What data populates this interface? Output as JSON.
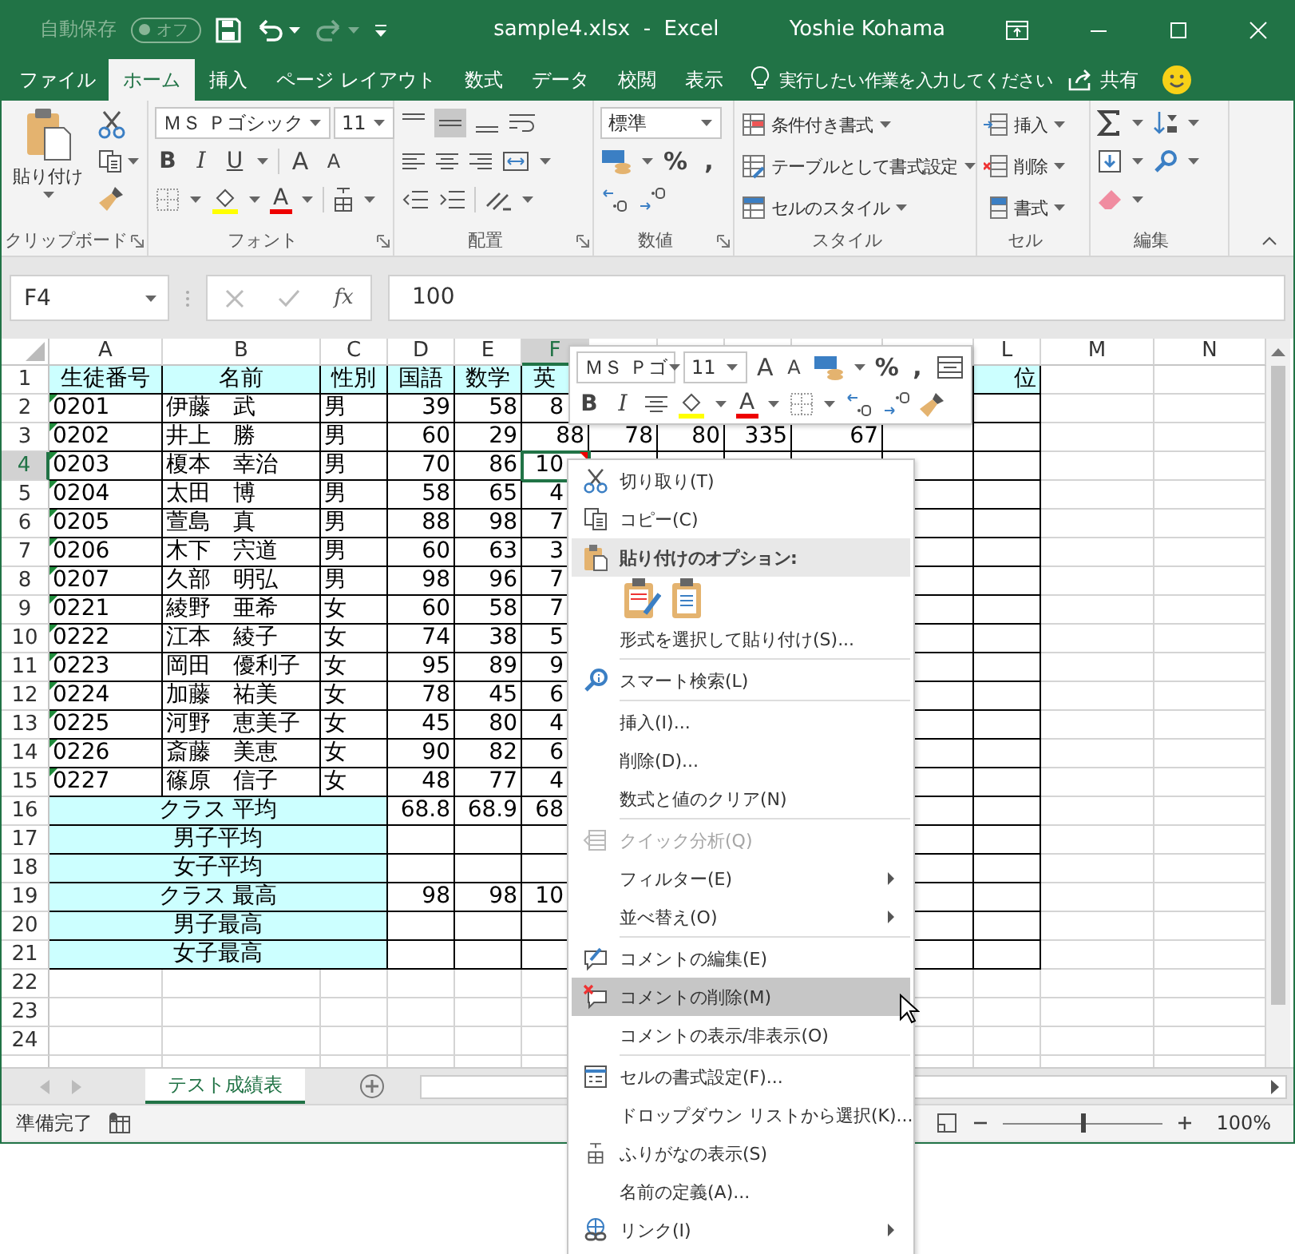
{
  "title_bar": {
    "autosave_label": "自動保存",
    "autosave_state": "オフ",
    "autosave_on": false,
    "redo_enabled": false,
    "title": "sample4.xlsx  -  Excel",
    "user": "Yoshie Kohama"
  },
  "tabs": [
    {
      "label": "ファイル",
      "selected": false
    },
    {
      "label": "ホーム",
      "selected": true
    },
    {
      "label": "挿入",
      "selected": false
    },
    {
      "label": "ページ レイアウト",
      "selected": false
    },
    {
      "label": "数式",
      "selected": false
    },
    {
      "label": "データ",
      "selected": false
    },
    {
      "label": "校閲",
      "selected": false
    },
    {
      "label": "表示",
      "selected": false
    }
  ],
  "tell_me": "実行したい作業を入力してください",
  "share": "共有",
  "ribbon": {
    "clipboard": {
      "paste": "貼り付け",
      "label": "クリップボード"
    },
    "font": {
      "font_name": "ＭＳ Ｐゴシック",
      "font_size": "11",
      "bold": "B",
      "italic": "I",
      "underline": "U",
      "grow": "A",
      "shrink": "A",
      "font_color": "A",
      "label": "フォント"
    },
    "alignment": {
      "label": "配置"
    },
    "number": {
      "format": "標準",
      "percent": "%",
      "comma": ",",
      "label": "数値"
    },
    "styles": {
      "items": [
        "条件付き書式",
        "テーブルとして書式設定",
        "セルのスタイル"
      ],
      "label": "スタイル"
    },
    "cells": {
      "items": [
        "挿入",
        "削除",
        "書式"
      ],
      "label": "セル"
    },
    "editing": {
      "label": "編集"
    }
  },
  "formula_bar": {
    "name_box": "F4",
    "function_button": "fx",
    "value": "100"
  },
  "sheet": {
    "columns": [
      {
        "label": "A",
        "selected": false
      },
      {
        "label": "B",
        "selected": false
      },
      {
        "label": "C",
        "selected": false
      },
      {
        "label": "D",
        "selected": false
      },
      {
        "label": "E",
        "selected": false
      },
      {
        "label": "F",
        "selected": true
      },
      {
        "selected": false
      },
      {
        "selected": false
      },
      {
        "selected": false
      },
      {
        "selected": false
      },
      {
        "selected": false
      },
      {
        "label": "L",
        "selected": false
      },
      {
        "label": "M",
        "selected": false
      },
      {
        "label": "N",
        "selected": false
      }
    ],
    "rows": [
      {
        "n": "1",
        "kind": "header",
        "selected": false,
        "cells": {
          "A": "生徒番号",
          "B": "名前",
          "C": "性別",
          "D": "国語",
          "E": "数学",
          "F": "英",
          "L": "位"
        }
      },
      {
        "n": "2",
        "kind": "data",
        "selected": false,
        "flag": true,
        "cells": {
          "A": "0201",
          "B": "伊藤　武",
          "C": "男",
          "D": "39",
          "E": "58",
          "F": "8"
        }
      },
      {
        "n": "3",
        "kind": "data",
        "selected": false,
        "flag": true,
        "cells": {
          "A": "0202",
          "B": "井上　勝",
          "C": "男",
          "D": "60",
          "E": "29",
          "F": "88",
          "G": "78",
          "H": "80",
          "I": "335",
          "J": "67"
        }
      },
      {
        "n": "4",
        "kind": "data",
        "selected": true,
        "flag": true,
        "cells": {
          "A": "0203",
          "B": "榎本　幸治",
          "C": "男",
          "D": "70",
          "E": "86",
          "F": {
            "text": "10",
            "comment": true
          }
        }
      },
      {
        "n": "5",
        "kind": "data",
        "selected": false,
        "flag": true,
        "cells": {
          "A": "0204",
          "B": "太田　博",
          "C": "男",
          "D": "58",
          "E": "65",
          "F": "4"
        }
      },
      {
        "n": "6",
        "kind": "data",
        "selected": false,
        "flag": true,
        "cells": {
          "A": "0205",
          "B": "萱島　真",
          "C": "男",
          "D": "88",
          "E": "98",
          "F": "7"
        }
      },
      {
        "n": "7",
        "kind": "data",
        "selected": false,
        "flag": true,
        "cells": {
          "A": "0206",
          "B": "木下　宍道",
          "C": "男",
          "D": "60",
          "E": "63",
          "F": "3"
        }
      },
      {
        "n": "8",
        "kind": "data",
        "selected": false,
        "flag": true,
        "cells": {
          "A": "0207",
          "B": "久部　明弘",
          "C": "男",
          "D": "98",
          "E": "96",
          "F": "7"
        }
      },
      {
        "n": "9",
        "kind": "data",
        "selected": false,
        "flag": true,
        "cells": {
          "A": "0221",
          "B": "綾野　亜希",
          "C": "女",
          "D": "60",
          "E": "58",
          "F": "7"
        }
      },
      {
        "n": "10",
        "kind": "data",
        "selected": false,
        "flag": true,
        "cells": {
          "A": "0222",
          "B": "江本　綾子",
          "C": "女",
          "D": "74",
          "E": "38",
          "F": "5"
        }
      },
      {
        "n": "11",
        "kind": "data",
        "selected": false,
        "flag": true,
        "cells": {
          "A": "0223",
          "B": "岡田　優利子",
          "C": "女",
          "D": "95",
          "E": "89",
          "F": "9"
        }
      },
      {
        "n": "12",
        "kind": "data",
        "selected": false,
        "flag": true,
        "cells": {
          "A": "0224",
          "B": "加藤　祐美",
          "C": "女",
          "D": "78",
          "E": "45",
          "F": "6"
        }
      },
      {
        "n": "13",
        "kind": "data",
        "selected": false,
        "flag": true,
        "cells": {
          "A": "0225",
          "B": "河野　恵美子",
          "C": "女",
          "D": "45",
          "E": "80",
          "F": "4"
        }
      },
      {
        "n": "14",
        "kind": "data",
        "selected": false,
        "flag": true,
        "cells": {
          "A": "0226",
          "B": "斎藤　美恵",
          "C": "女",
          "D": "90",
          "E": "82",
          "F": "6"
        }
      },
      {
        "n": "15",
        "kind": "data",
        "selected": false,
        "flag": true,
        "cells": {
          "A": "0227",
          "B": "篠原　信子",
          "C": "女",
          "D": "48",
          "E": "77",
          "F": "4"
        }
      },
      {
        "n": "16",
        "kind": "summary",
        "selected": false,
        "cells": {
          "A": "クラス 平均",
          "D": "68.8",
          "E": "68.9",
          "F": "68"
        }
      },
      {
        "n": "17",
        "kind": "summary",
        "selected": false,
        "cells": {
          "A": "男子平均"
        }
      },
      {
        "n": "18",
        "kind": "summary",
        "selected": false,
        "cells": {
          "A": "女子平均"
        }
      },
      {
        "n": "19",
        "kind": "summary",
        "selected": false,
        "cells": {
          "A": "クラス 最高",
          "D": "98",
          "E": "98",
          "F": "10"
        }
      },
      {
        "n": "20",
        "kind": "summary",
        "selected": false,
        "cells": {
          "A": "男子最高"
        }
      },
      {
        "n": "21",
        "kind": "summary",
        "selected": false,
        "cells": {
          "A": "女子最高"
        }
      },
      {
        "n": "22",
        "kind": "blank",
        "selected": false
      },
      {
        "n": "23",
        "kind": "blank",
        "selected": false
      },
      {
        "n": "24",
        "kind": "blank",
        "selected": false
      },
      {
        "kind": "blank",
        "selected": false
      }
    ]
  },
  "sheet_tabs": [
    {
      "label": "テスト成績表",
      "selected": true
    }
  ],
  "status_bar": {
    "status": "準備完了",
    "zoom": {
      "level": 0.5,
      "reading": "100%"
    }
  },
  "mini_toolbar": {
    "font_name": "ＭＳ Ｐゴ",
    "font_size": "11",
    "grow": "A",
    "shrink": "A",
    "percent": "%",
    "comma": ",",
    "bold": "B",
    "italic": "I",
    "font_color": "A"
  },
  "context_menu": {
    "items": [
      {
        "kind": "item",
        "label": "切り取り(T)",
        "disabled": false,
        "selected": false,
        "submenu": false
      },
      {
        "kind": "item",
        "label": "コピー(C)",
        "disabled": false,
        "selected": false,
        "submenu": false
      },
      {
        "kind": "header",
        "label": "貼り付けのオプション:"
      },
      {
        "kind": "paste_options"
      },
      {
        "kind": "item",
        "label": "形式を選択して貼り付け(S)...",
        "disabled": false,
        "selected": false,
        "submenu": false
      },
      {
        "kind": "separator"
      },
      {
        "kind": "item",
        "label": "スマート検索(L)",
        "disabled": false,
        "selected": false,
        "submenu": false
      },
      {
        "kind": "separator"
      },
      {
        "kind": "item",
        "label": "挿入(I)...",
        "disabled": false,
        "selected": false,
        "submenu": false
      },
      {
        "kind": "item",
        "label": "削除(D)...",
        "disabled": false,
        "selected": false,
        "submenu": false
      },
      {
        "kind": "item",
        "label": "数式と値のクリア(N)",
        "disabled": false,
        "selected": false,
        "submenu": false
      },
      {
        "kind": "separator"
      },
      {
        "kind": "item",
        "label": "クイック分析(Q)",
        "disabled": true,
        "selected": false,
        "submenu": false
      },
      {
        "kind": "item",
        "label": "フィルター(E)",
        "disabled": false,
        "selected": false,
        "submenu": true
      },
      {
        "kind": "item",
        "label": "並べ替え(O)",
        "disabled": false,
        "selected": false,
        "submenu": true
      },
      {
        "kind": "separator"
      },
      {
        "kind": "item",
        "label": "コメントの編集(E)",
        "disabled": false,
        "selected": false,
        "submenu": false
      },
      {
        "kind": "item",
        "label": "コメントの削除(M)",
        "disabled": false,
        "selected": true,
        "submenu": false
      },
      {
        "kind": "item",
        "label": "コメントの表示/非表示(O)",
        "disabled": false,
        "selected": false,
        "submenu": false
      },
      {
        "kind": "separator"
      },
      {
        "kind": "item",
        "label": "セルの書式設定(F)...",
        "disabled": false,
        "selected": false,
        "submenu": false
      },
      {
        "kind": "item",
        "label": "ドロップダウン リストから選択(K)...",
        "disabled": false,
        "selected": false,
        "submenu": false
      },
      {
        "kind": "item",
        "label": "ふりがなの表示(S)",
        "disabled": false,
        "selected": false,
        "submenu": false
      },
      {
        "kind": "item",
        "label": "名前の定義(A)...",
        "disabled": false,
        "selected": false,
        "submenu": false
      },
      {
        "kind": "item",
        "label": "リンク(I)",
        "disabled": false,
        "selected": false,
        "submenu": true
      }
    ]
  }
}
